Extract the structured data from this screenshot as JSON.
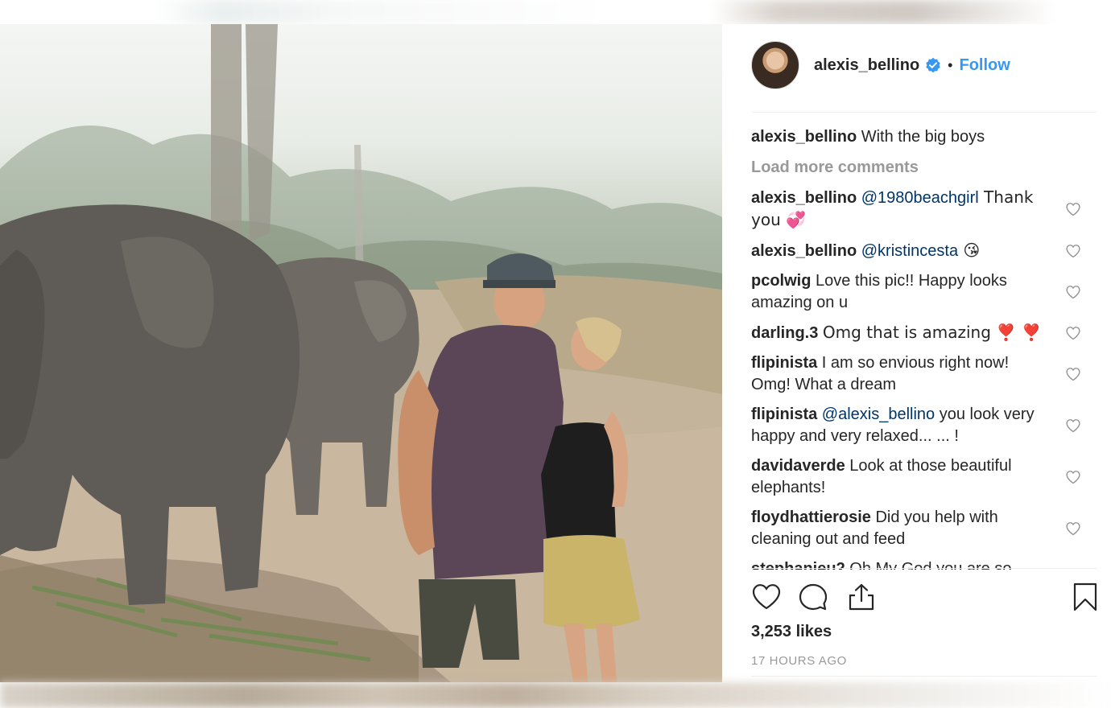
{
  "post": {
    "author": "alexis_bellino",
    "follow_label": "Follow",
    "separator": "•",
    "caption_text": "With the big boys",
    "load_more_label": "Load more comments",
    "likes": "3,253 likes",
    "time": "17 HOURS AGO"
  },
  "comments": [
    {
      "user": "alexis_bellino",
      "mention": "@1980beachgirl",
      "text": " Thank you 💞"
    },
    {
      "user": "alexis_bellino",
      "mention": "@kristincesta",
      "text": " 😘"
    },
    {
      "user": "pcolwig",
      "mention": "",
      "text": "Love this pic!! Happy looks amazing on u"
    },
    {
      "user": "darling.3",
      "mention": "",
      "text": "Omg that is amazing ❣️ ❣️"
    },
    {
      "user": "flipinista",
      "mention": "",
      "text": "I am so envious right now! Omg! What a dream"
    },
    {
      "user": "flipinista",
      "mention": "@alexis_bellino",
      "text": " you look very happy and very relaxed... ... !"
    },
    {
      "user": "davidaverde",
      "mention": "",
      "text": "Look at those beautiful elephants!"
    },
    {
      "user": "floydhattierosie",
      "mention": "",
      "text": "Did you help with cleaning out and feed"
    },
    {
      "user": "stephanieu2",
      "mention": "",
      "text": "Oh My God you are so"
    }
  ],
  "colors": {
    "accent": "#3897f0",
    "mention": "#003569",
    "muted": "#999999",
    "text": "#262626"
  },
  "icons": [
    "verified-badge-icon",
    "heart-outline-icon",
    "comment-bubble-icon",
    "share-icon",
    "bookmark-icon"
  ]
}
